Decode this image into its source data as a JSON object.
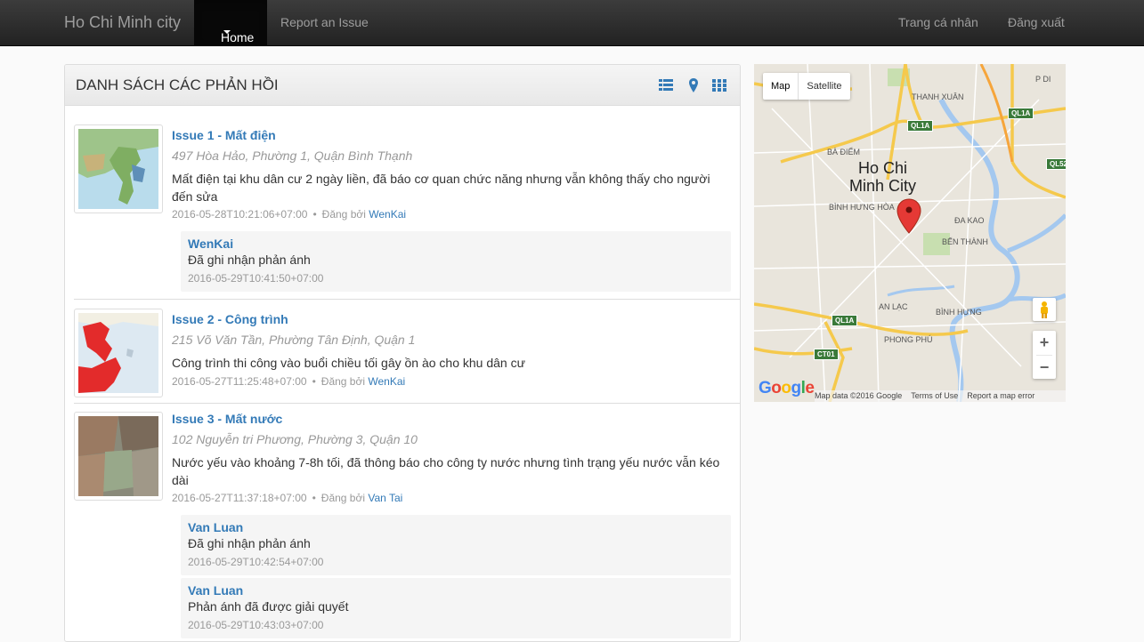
{
  "navbar": {
    "brand": "Ho Chi Minh city",
    "home": "Home",
    "report": "Report an Issue",
    "profile": "Trang cá nhân",
    "logout": "Đăng xuất"
  },
  "panel": {
    "title": "DANH SÁCH CÁC PHẢN HỒI",
    "view_icons": [
      "list-icon",
      "map-marker-icon",
      "grid-icon"
    ]
  },
  "issues": [
    {
      "title": "Issue 1 - Mất điện",
      "address": "497 Hòa Hảo, Phường 1, Quận Bình Thạnh",
      "description": "Mất điện tại khu dân cư 2 ngày liền, đã báo cơ quan chức năng nhưng vẫn không thấy cho người đến sửa",
      "time": "2016-05-28T10:21:06+07:00",
      "posted_by_label": "Đăng bởi",
      "author": "WenKai",
      "replies": [
        {
          "author": "WenKai",
          "text": "Đã ghi nhận phản ánh",
          "time": "2016-05-29T10:41:50+07:00"
        }
      ]
    },
    {
      "title": "Issue 2 - Công trình",
      "address": "215 Võ Văn Tần, Phường Tân Định, Quận 1",
      "description": "Công trình thi công vào buổi chiều tối gây ồn ào cho khu dân cư",
      "time": "2016-05-27T11:25:48+07:00",
      "posted_by_label": "Đăng bởi",
      "author": "WenKai",
      "replies": []
    },
    {
      "title": "Issue 3 - Mất nước",
      "address": "102 Nguyễn tri Phương, Phường 3, Quận 10",
      "description": "Nước yếu vào khoảng 7-8h tối, đã thông báo cho công ty nước nhưng tình trạng yếu nước vẫn kéo dài",
      "time": "2016-05-27T11:37:18+07:00",
      "posted_by_label": "Đăng bởi",
      "author": "Van Tai",
      "replies": [
        {
          "author": "Van Luan",
          "text": "Đã ghi nhận phản ánh",
          "time": "2016-05-29T10:42:54+07:00"
        },
        {
          "author": "Van Luan",
          "text": "Phản ánh đã được giải quyết",
          "time": "2016-05-29T10:43:03+07:00"
        }
      ]
    }
  ],
  "map": {
    "type_map": "Map",
    "type_satellite": "Satellite",
    "city_line1": "Ho Chi",
    "city_line2": "Minh City",
    "labels": {
      "thanh_xuan": "THANH XUÂN",
      "p_di": "P DI",
      "ba_diem": "BÀ ĐIỂM",
      "binh_hung_hoa": "BÌNH HƯNG HÒA",
      "da_kao": "ĐA KAO",
      "ben_thanh": "BẾN THÀNH",
      "binh_hung": "BÌNH HƯNG",
      "an_lac": "AN LẠC",
      "phong_phu": "PHONG PHÚ"
    },
    "signs": {
      "ql1a_a": "QL1A",
      "ql1a_b": "QL1A",
      "ql1a_c": "QL1A",
      "ql52": "QL52",
      "ct01": "CT01"
    },
    "google": "Google",
    "footer": {
      "data": "Map data ©2016 Google",
      "terms": "Terms of Use",
      "report": "Report a map error"
    }
  }
}
